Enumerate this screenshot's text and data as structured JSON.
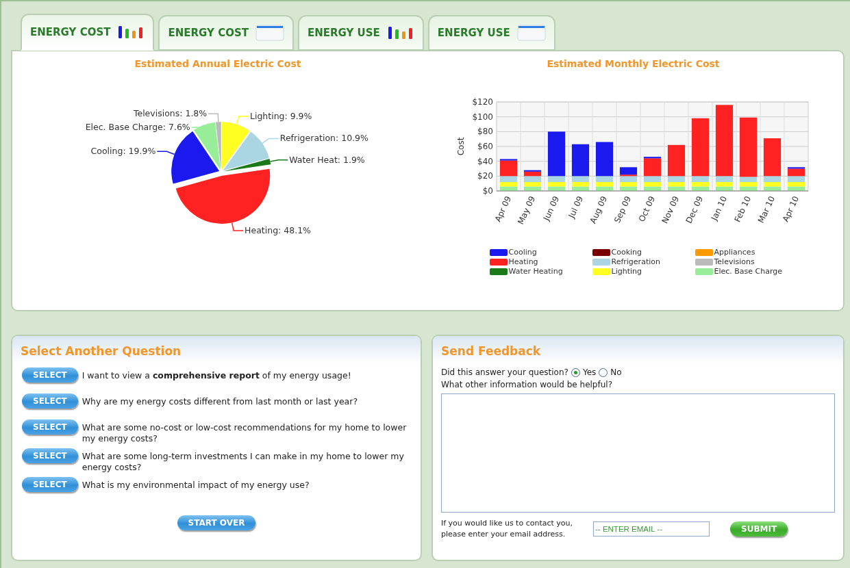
{
  "tabs": [
    {
      "label": "ENERGY COST",
      "kind": "chart",
      "selected": true
    },
    {
      "label": "ENERGY COST",
      "kind": "table",
      "selected": false
    },
    {
      "label": "ENERGY USE",
      "kind": "chart",
      "selected": false
    },
    {
      "label": "ENERGY USE",
      "kind": "table",
      "selected": false
    }
  ],
  "annual_chart": {
    "chart_data": {
      "type": "pie",
      "title": "Estimated Annual Electric Cost",
      "values": [
        9.9,
        10.9,
        1.9,
        48.1,
        19.9,
        7.6,
        1.8
      ],
      "colors": [
        "#ffff22",
        "#a9d6e2",
        "#1a7a1a",
        "#ff2222",
        "#1a1aee",
        "#98ee98",
        "#bbbbbb"
      ],
      "value_labels": [
        "Lighting: 9.9%",
        "Refrigeration: 10.9%",
        "Water Heat: 1.9%",
        "Heating: 48.1%",
        "Cooling: 19.9%",
        "Elec. Base Charge: 7.6%",
        "Televisions: 1.8%"
      ]
    }
  },
  "monthly_chart": {
    "chart_data": {
      "type": "bar",
      "stacked": true,
      "grid": true,
      "title": "Estimated Monthly Electric Cost",
      "ylabel": "Cost",
      "categories": [
        "Apr 09",
        "May 09",
        "Jun 09",
        "Jul 09",
        "Aug 09",
        "Sep 09",
        "Oct 09",
        "Nov 09",
        "Dec 09",
        "Jan 10",
        "Feb 10",
        "Mar 10",
        "Apr 10"
      ],
      "ylim": [
        0,
        120
      ],
      "yticks": [
        {
          "value": 0,
          "label": "$0"
        },
        {
          "value": 20,
          "label": "$20"
        },
        {
          "value": 40,
          "label": "$40"
        },
        {
          "value": 60,
          "label": "$60"
        },
        {
          "value": 80,
          "label": "$80"
        },
        {
          "value": 100,
          "label": "$100"
        },
        {
          "value": 120,
          "label": "$120"
        }
      ],
      "series": [
        {
          "name": "Cooling",
          "color": "#1a1aee",
          "values": [
            2,
            2,
            60,
            43,
            46,
            10,
            2,
            0,
            0,
            0,
            0,
            0,
            2
          ]
        },
        {
          "name": "Cooking",
          "color": "#7a0000",
          "values": [
            0,
            0,
            0,
            0,
            0,
            0,
            0,
            0,
            0,
            0,
            0,
            0,
            0
          ]
        },
        {
          "name": "Appliances",
          "color": "#ff9900",
          "values": [
            0,
            0,
            0,
            0,
            0,
            0,
            0,
            0,
            0,
            0,
            0,
            0,
            0
          ]
        },
        {
          "name": "Heating",
          "color": "#ff2222",
          "values": [
            21,
            6,
            0,
            0,
            0,
            2,
            24,
            42,
            78,
            96,
            80,
            51,
            10
          ]
        },
        {
          "name": "Refrigeration",
          "color": "#a9d6e2",
          "values": [
            8,
            8,
            8,
            8,
            8,
            8,
            8,
            8,
            8,
            8,
            7,
            8,
            8
          ]
        },
        {
          "name": "Televisions",
          "color": "#bbbbbb",
          "values": [
            0,
            0,
            0,
            0,
            0,
            0,
            0,
            0,
            0,
            0,
            0,
            0,
            0
          ]
        },
        {
          "name": "Water Heating",
          "color": "#1a7a1a",
          "values": [
            0,
            0,
            0,
            0,
            0,
            0,
            0,
            0,
            0,
            0,
            0,
            0,
            0
          ]
        },
        {
          "name": "Lighting",
          "color": "#ffff22",
          "values": [
            6,
            6,
            6,
            6,
            6,
            6,
            6,
            6,
            6,
            6,
            6,
            6,
            6
          ]
        },
        {
          "name": "Elec. Base Charge",
          "color": "#98ee98",
          "values": [
            6,
            6,
            6,
            6,
            6,
            6,
            6,
            6,
            6,
            6,
            6,
            6,
            6
          ]
        }
      ]
    }
  },
  "questions": {
    "title": "Select Another Question",
    "items": [
      {
        "button": "SELECT",
        "text": "I want to view a **comprehensive report** of my energy usage!"
      },
      {
        "button": "SELECT",
        "text": "Why are my energy costs different from last month or last year?"
      },
      {
        "button": "SELECT",
        "text": "What are some no-cost or low-cost recommendations for my home to lower my energy costs?"
      },
      {
        "button": "SELECT",
        "text": "What are some long-term investments I can make in my home to lower my energy costs?"
      },
      {
        "button": "SELECT",
        "text": "What is my environmental impact of my energy use?"
      }
    ],
    "start_over": "START OVER"
  },
  "feedback": {
    "title": "Send Feedback",
    "question": "Did this answer your question?",
    "options": [
      {
        "label": "Yes",
        "selected": true
      },
      {
        "label": "No",
        "selected": false
      }
    ],
    "prompt": "What other information would be helpful?",
    "contact_note": "If you would like us to contact you,\nplease enter your email address.",
    "email": {
      "placeholder": "-- ENTER EMAIL --"
    },
    "submit": "SUBMIT"
  }
}
